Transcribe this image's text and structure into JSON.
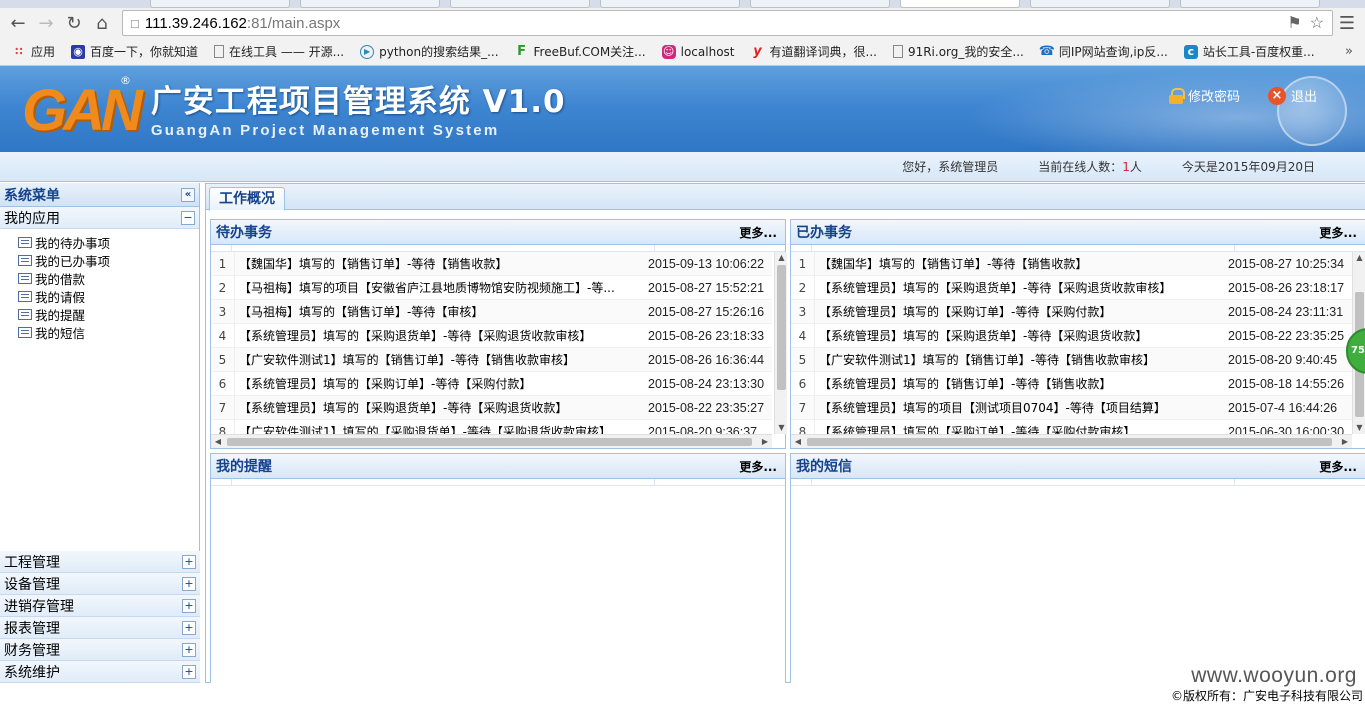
{
  "browser": {
    "url_host": "111.39.246.162",
    "url_rest": ":81/main.aspx",
    "bookmarks": [
      {
        "label": "应用",
        "icon": "apps-icon"
      },
      {
        "label": "百度一下，你就知道",
        "icon": "baidu-icon"
      },
      {
        "label": "在线工具 —— 开源...",
        "icon": "page-icon"
      },
      {
        "label": "python的搜索结果_...",
        "icon": "play-icon"
      },
      {
        "label": "FreeBuf.COM关注...",
        "icon": "freebuf-icon"
      },
      {
        "label": "localhost",
        "icon": "localhost-icon"
      },
      {
        "label": "有道翻译词典，很...",
        "icon": "youdao-icon"
      },
      {
        "label": "91Ri.org_我的安全...",
        "icon": "page-icon"
      },
      {
        "label": "同IP网站查询,ip反...",
        "icon": "phone-icon"
      },
      {
        "label": "站长工具-百度权重...",
        "icon": "chinaz-icon"
      }
    ],
    "more": "»"
  },
  "header": {
    "logo_mark": "GAN",
    "reg": "®",
    "title": "广安工程项目管理系统 V1.0",
    "subtitle": "GuangAn Project Management System",
    "change_password": "修改密码",
    "logout": "退出"
  },
  "infobar": {
    "greeting": "您好，系统管理员",
    "online_label": "当前在线人数：",
    "online_count": "1",
    "online_unit": "人",
    "today": "今天是2015年09月20日"
  },
  "sidebar": {
    "title": "系统菜单",
    "collapse": "«",
    "open_group": "我的应用",
    "items": [
      "我的待办事项",
      "我的已办事项",
      "我的借款",
      "我的请假",
      "我的提醒",
      "我的短信"
    ],
    "groups": [
      "工程管理",
      "设备管理",
      "进销存管理",
      "报表管理",
      "财务管理",
      "系统维护"
    ]
  },
  "tabs": {
    "active": "工作概况"
  },
  "todo": {
    "title": "待办事务",
    "more": "更多...",
    "rows": [
      {
        "num": "1",
        "text": "【魏国华】填写的【销售订单】-等待【销售收款】",
        "date": "2015-09-13 10:06:22"
      },
      {
        "num": "2",
        "text": "【马祖梅】填写的项目【安徽省庐江县地质博物馆安防视频施工】-等...",
        "date": "2015-08-27 15:52:21"
      },
      {
        "num": "3",
        "text": "【马祖梅】填写的【销售订单】-等待【审核】",
        "date": "2015-08-27 15:26:16"
      },
      {
        "num": "4",
        "text": "【系统管理员】填写的【采购退货单】-等待【采购退货收款审核】",
        "date": "2015-08-26 23:18:33"
      },
      {
        "num": "5",
        "text": "【广安软件测试1】填写的【销售订单】-等待【销售收款审核】",
        "date": "2015-08-26 16:36:44"
      },
      {
        "num": "6",
        "text": "【系统管理员】填写的【采购订单】-等待【采购付款】",
        "date": "2015-08-24 23:13:30"
      },
      {
        "num": "7",
        "text": "【系统管理员】填写的【采购退货单】-等待【采购退货收款】",
        "date": "2015-08-22 23:35:27"
      },
      {
        "num": "8",
        "text": "【广安软件测试1】填写的【采购退货单】-等待【采购退货收款审核】",
        "date": "2015-08-20 9:36:37"
      }
    ]
  },
  "done": {
    "title": "已办事务",
    "more": "更多...",
    "rows": [
      {
        "num": "1",
        "text": "【魏国华】填写的【销售订单】-等待【销售收款】",
        "date": "2015-08-27 10:25:34"
      },
      {
        "num": "2",
        "text": "【系统管理员】填写的【采购退货单】-等待【采购退货收款审核】",
        "date": "2015-08-26 23:18:17"
      },
      {
        "num": "3",
        "text": "【系统管理员】填写的【采购订单】-等待【采购付款】",
        "date": "2015-08-24 23:11:31"
      },
      {
        "num": "4",
        "text": "【系统管理员】填写的【采购退货单】-等待【采购退货收款】",
        "date": "2015-08-22 23:35:25"
      },
      {
        "num": "5",
        "text": "【广安软件测试1】填写的【销售订单】-等待【销售收款审核】",
        "date": "2015-08-20 9:40:45"
      },
      {
        "num": "6",
        "text": "【系统管理员】填写的【销售订单】-等待【销售收款】",
        "date": "2015-08-18 14:55:26"
      },
      {
        "num": "7",
        "text": "【系统管理员】填写的项目【测试项目0704】-等待【项目结算】",
        "date": "2015-07-4 16:44:26"
      },
      {
        "num": "8",
        "text": "【系统管理员】填写的【采购订单】-等待【采购付款审核】",
        "date": "2015-06-30 16:00:30"
      }
    ]
  },
  "reminders": {
    "title": "我的提醒",
    "more": "更多..."
  },
  "messages": {
    "title": "我的短信",
    "more": "更多..."
  },
  "footer": {
    "copyright": "©版权所有：广安电子科技有限公司",
    "watermark": "www.wooyun.org",
    "badge": "75"
  }
}
